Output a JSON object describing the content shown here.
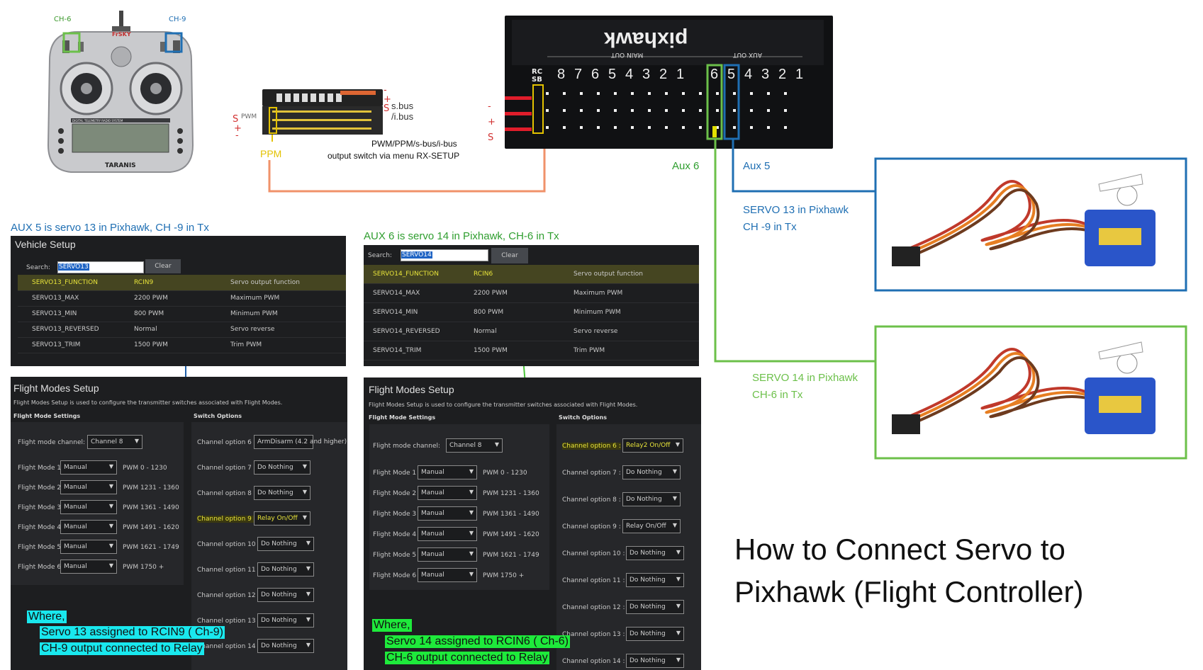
{
  "transmitter": {
    "ch_left": "CH-6",
    "ch_right": "CH-9",
    "brand": "TARANIS",
    "logo": "FrSKY",
    "screen_text": "DIGITAL TELEMETRY RADIO SYSTEM"
  },
  "receiver": {
    "label_pwm": "PWM",
    "label_sbus": "s.bus\n/i.bus",
    "label_ppm": "PPM",
    "switch_text_1": "PWM/PPM/s-bus/i-bus",
    "switch_text_2": "output switch via menu RX-SETUP",
    "left_marks": [
      "S",
      "+",
      "-"
    ],
    "right_marks": [
      "-",
      "+",
      "S"
    ]
  },
  "pixhawk": {
    "brand": "pixhawk",
    "main_out": "MAIN OUT",
    "aux_out": "AUX OUT",
    "rc_label": "RC\nSB",
    "main_numbers": [
      "8",
      "7",
      "6",
      "5",
      "4",
      "3",
      "2",
      "1"
    ],
    "aux_numbers": [
      "6",
      "5",
      "4",
      "3",
      "2",
      "1"
    ],
    "pin_marks": [
      "-",
      "+",
      "S"
    ]
  },
  "labels": {
    "aux6": "Aux 6",
    "aux5": "Aux 5",
    "servo13_line1": "SERVO 13 in Pixhawk",
    "servo13_line2": "CH -9 in Tx",
    "servo14_line1": "SERVO 14 in Pixhawk",
    "servo14_line2": "CH-6 in Tx"
  },
  "left_caption": "AUX 5 is servo 13 in Pixhawk, CH -9 in Tx",
  "mid_caption": "AUX 6 is servo 14 in Pixhawk, CH-6 in Tx",
  "vs_left": {
    "title": "Vehicle Setup",
    "search_label": "Search:",
    "search_value": "SERVO13",
    "clear": "Clear",
    "rows": [
      {
        "name": "SERVO13_FUNCTION",
        "value": "RCIN9",
        "desc": "Servo output function"
      },
      {
        "name": "SERVO13_MAX",
        "value": "2200 PWM",
        "desc": "Maximum PWM"
      },
      {
        "name": "SERVO13_MIN",
        "value": "800 PWM",
        "desc": "Minimum PWM"
      },
      {
        "name": "SERVO13_REVERSED",
        "value": "Normal",
        "desc": "Servo reverse"
      },
      {
        "name": "SERVO13_TRIM",
        "value": "1500 PWM",
        "desc": "Trim PWM"
      }
    ]
  },
  "vs_mid": {
    "search_label": "Search:",
    "search_value": "SERVO14",
    "clear": "Clear",
    "rows": [
      {
        "name": "SERVO14_FUNCTION",
        "value": "RCIN6",
        "desc": "Servo output function"
      },
      {
        "name": "SERVO14_MAX",
        "value": "2200 PWM",
        "desc": "Maximum PWM"
      },
      {
        "name": "SERVO14_MIN",
        "value": "800 PWM",
        "desc": "Minimum PWM"
      },
      {
        "name": "SERVO14_REVERSED",
        "value": "Normal",
        "desc": "Servo reverse"
      },
      {
        "name": "SERVO14_TRIM",
        "value": "1500 PWM",
        "desc": "Trim PWM"
      }
    ]
  },
  "fm_left": {
    "title": "Flight Modes Setup",
    "desc": "Flight Modes Setup is used to configure the transmitter switches associated with Flight Modes.",
    "settings_title": "Flight Mode Settings",
    "switch_title": "Switch Options",
    "channel_label": "Flight mode channel:",
    "channel_value": "Channel 8",
    "modes": [
      {
        "label": "Flight Mode 1",
        "value": "Manual",
        "pwm": "PWM 0 - 1230"
      },
      {
        "label": "Flight Mode 2",
        "value": "Manual",
        "pwm": "PWM 1231 - 1360"
      },
      {
        "label": "Flight Mode 3",
        "value": "Manual",
        "pwm": "PWM 1361 - 1490"
      },
      {
        "label": "Flight Mode 4",
        "value": "Manual",
        "pwm": "PWM 1491 - 1620"
      },
      {
        "label": "Flight Mode 5",
        "value": "Manual",
        "pwm": "PWM 1621 - 1749"
      },
      {
        "label": "Flight Mode 6",
        "value": "Manual",
        "pwm": "PWM 1750 +"
      }
    ],
    "options": [
      {
        "label": "Channel option 6 :",
        "value": "ArmDisarm (4.2 and higher)"
      },
      {
        "label": "Channel option 7 :",
        "value": "Do Nothing"
      },
      {
        "label": "Channel option 8 :",
        "value": "Do Nothing"
      },
      {
        "label": "Channel option 9 :",
        "value": "Relay On/Off"
      },
      {
        "label": "Channel option 10 :",
        "value": "Do Nothing"
      },
      {
        "label": "Channel option 11 :",
        "value": "Do Nothing"
      },
      {
        "label": "Channel option 12 :",
        "value": "Do Nothing"
      },
      {
        "label": "Channel option 13 :",
        "value": "Do Nothing"
      },
      {
        "label": "Channel option 14 :",
        "value": "Do Nothing"
      }
    ],
    "note_where": "Where,",
    "note_1": "Servo 13 assigned to RCIN9 ( Ch-9)",
    "note_2": "CH-9 output connected to Relay"
  },
  "fm_mid": {
    "title": "Flight Modes Setup",
    "desc": "Flight Modes Setup is used to configure the transmitter switches associated with Flight Modes.",
    "settings_title": "Flight Mode Settings",
    "switch_title": "Switch Options",
    "channel_label": "Flight mode channel:",
    "channel_value": "Channel 8",
    "modes": [
      {
        "label": "Flight Mode 1",
        "value": "Manual",
        "pwm": "PWM 0 - 1230"
      },
      {
        "label": "Flight Mode 2",
        "value": "Manual",
        "pwm": "PWM 1231 - 1360"
      },
      {
        "label": "Flight Mode 3",
        "value": "Manual",
        "pwm": "PWM 1361 - 1490"
      },
      {
        "label": "Flight Mode 4",
        "value": "Manual",
        "pwm": "PWM 1491 - 1620"
      },
      {
        "label": "Flight Mode 5",
        "value": "Manual",
        "pwm": "PWM 1621 - 1749"
      },
      {
        "label": "Flight Mode 6",
        "value": "Manual",
        "pwm": "PWM 1750 +"
      }
    ],
    "options": [
      {
        "label": "Channel option 6 :",
        "value": "Relay2 On/Off"
      },
      {
        "label": "Channel option 7 :",
        "value": "Do Nothing"
      },
      {
        "label": "Channel option 8 :",
        "value": "Do Nothing"
      },
      {
        "label": "Channel option 9 :",
        "value": "Relay On/Off"
      },
      {
        "label": "Channel option 10 :",
        "value": "Do Nothing"
      },
      {
        "label": "Channel option 11 :",
        "value": "Do Nothing"
      },
      {
        "label": "Channel option 12 :",
        "value": "Do Nothing"
      },
      {
        "label": "Channel option 13 :",
        "value": "Do Nothing"
      },
      {
        "label": "Channel option 14 :",
        "value": "Do Nothing"
      }
    ],
    "note_where": "Where,",
    "note_1": "Servo 14 assigned to RCIN6 ( Ch-6)",
    "note_2": "CH-6 output connected to Relay"
  },
  "big_title_1": "How to Connect Servo to",
  "big_title_2": "Pixhawk (Flight Controller)",
  "colors": {
    "blue": "#1f6fb3",
    "green": "#6cc04a",
    "dark_panel": "#1d1e20",
    "highlight_yellow": "#e7e33a",
    "cyan": "#19e8ee",
    "bright_green": "#1eea3b"
  }
}
